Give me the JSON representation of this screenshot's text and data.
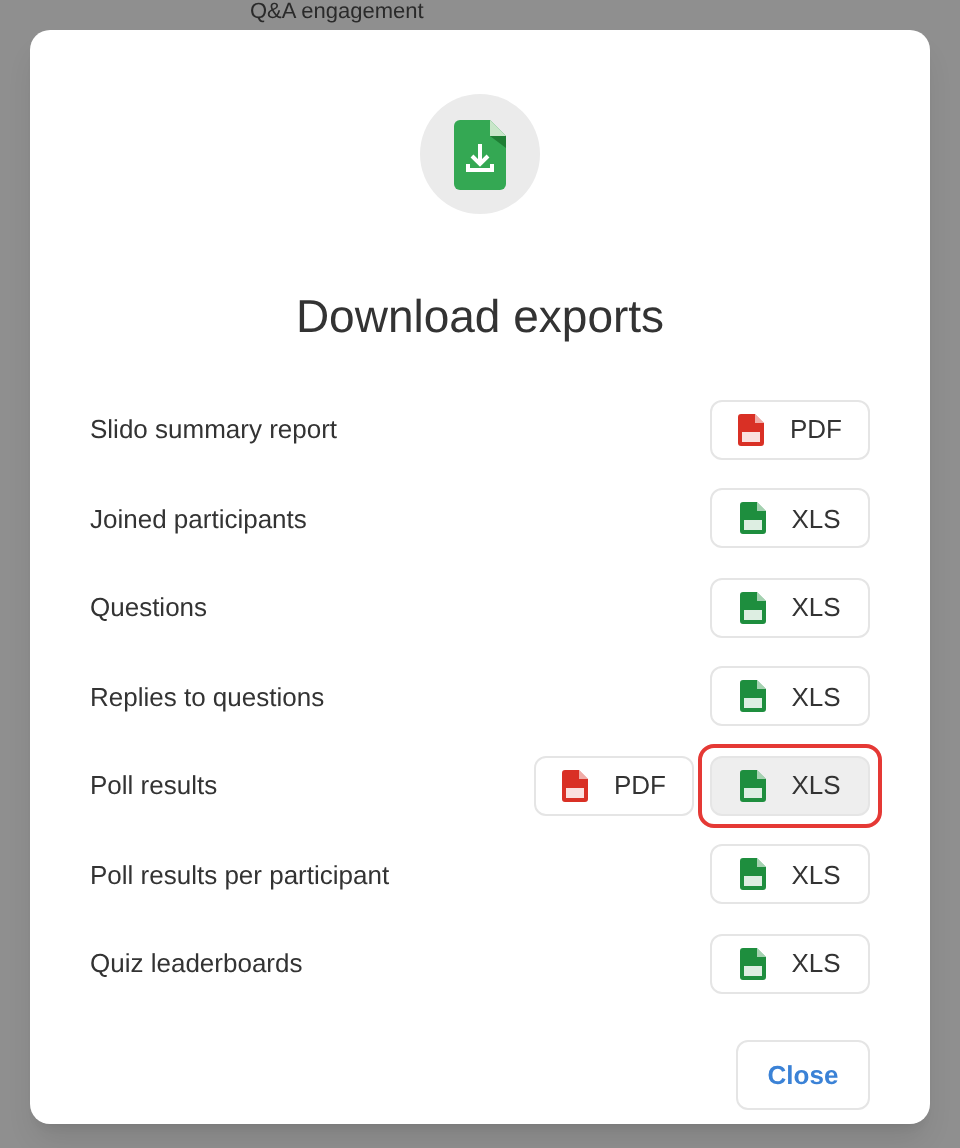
{
  "background": {
    "text": "Q&A engagement"
  },
  "dialog": {
    "title": "Download exports",
    "rows": [
      {
        "label": "Slido summary report",
        "buttons": [
          {
            "kind": "pdf",
            "label": "PDF",
            "hovered": false,
            "highlighted": false
          }
        ]
      },
      {
        "label": "Joined participants",
        "buttons": [
          {
            "kind": "xls",
            "label": "XLS",
            "hovered": false,
            "highlighted": false
          }
        ]
      },
      {
        "label": "Questions",
        "buttons": [
          {
            "kind": "xls",
            "label": "XLS",
            "hovered": false,
            "highlighted": false
          }
        ]
      },
      {
        "label": "Replies to questions",
        "buttons": [
          {
            "kind": "xls",
            "label": "XLS",
            "hovered": false,
            "highlighted": false
          }
        ]
      },
      {
        "label": "Poll results",
        "buttons": [
          {
            "kind": "pdf",
            "label": "PDF",
            "hovered": false,
            "highlighted": false
          },
          {
            "kind": "xls",
            "label": "XLS",
            "hovered": true,
            "highlighted": true
          }
        ]
      },
      {
        "label": "Poll results per participant",
        "buttons": [
          {
            "kind": "xls",
            "label": "XLS",
            "hovered": false,
            "highlighted": false
          }
        ]
      },
      {
        "label": "Quiz leaderboards",
        "buttons": [
          {
            "kind": "xls",
            "label": "XLS",
            "hovered": false,
            "highlighted": false
          }
        ]
      }
    ],
    "close": "Close"
  }
}
